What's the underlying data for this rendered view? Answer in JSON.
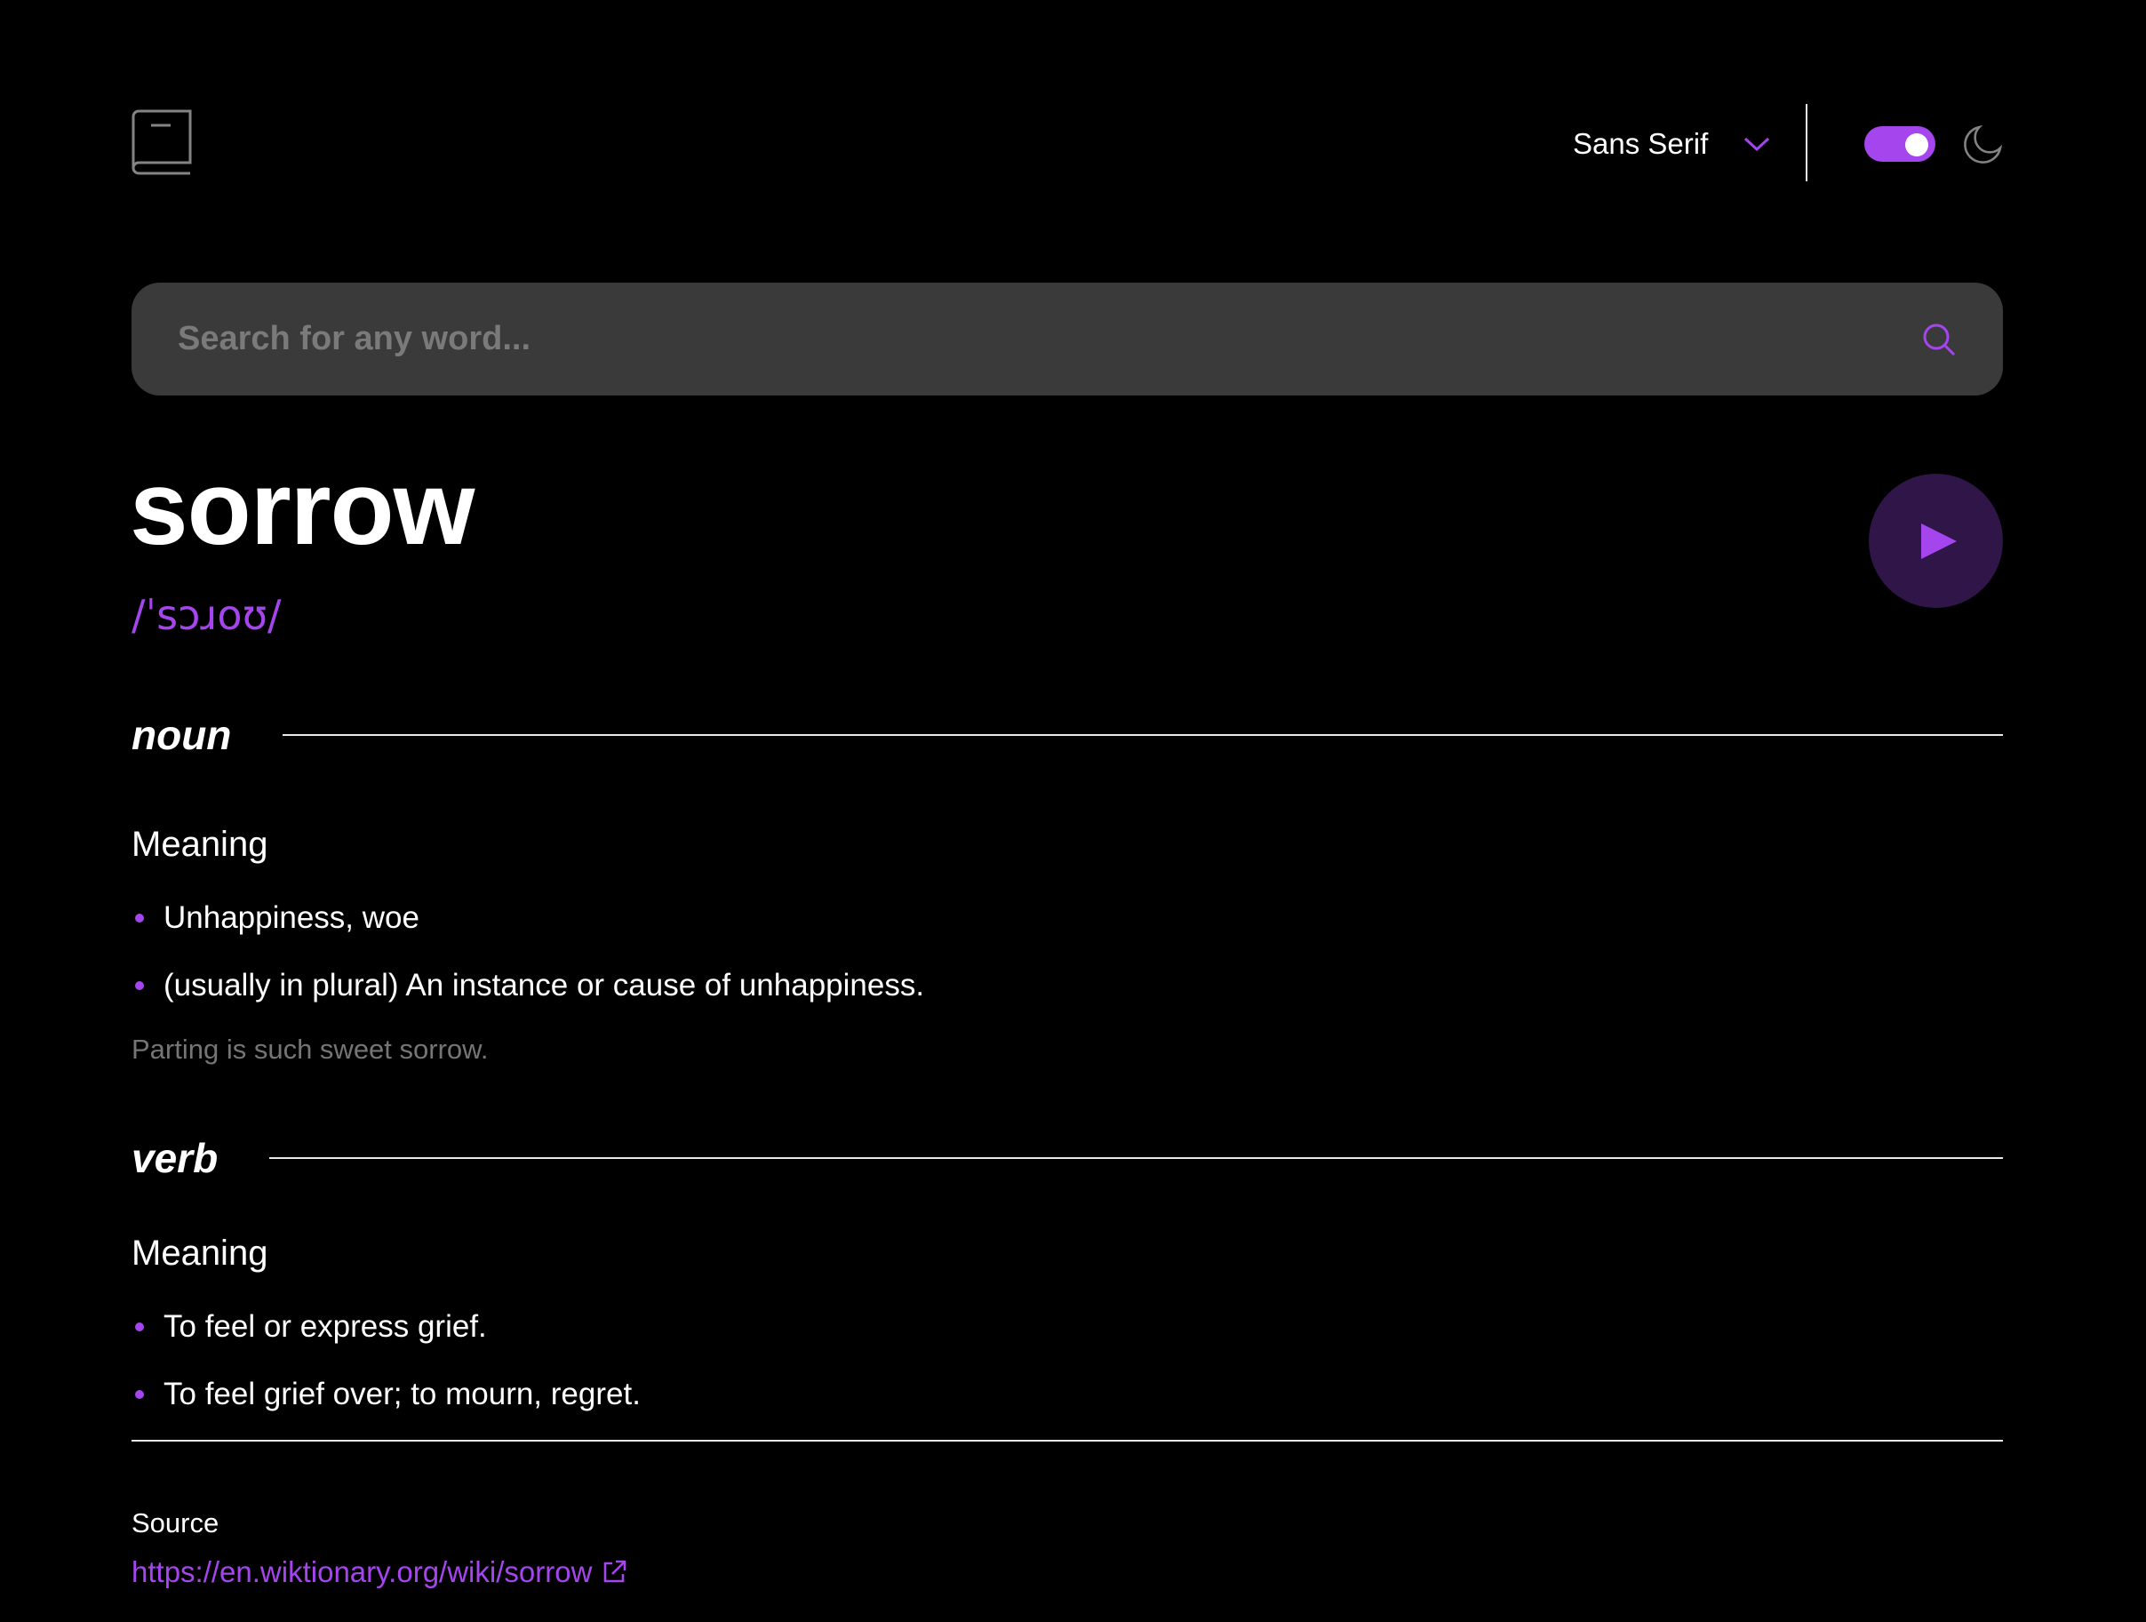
{
  "header": {
    "logo_icon": "book-icon",
    "font_select": {
      "selected": "Sans Serif",
      "icon": "chevron-down-icon"
    },
    "theme_toggle": {
      "on": true,
      "icon": "moon-icon"
    }
  },
  "search": {
    "placeholder": "Search for any word...",
    "value": "",
    "icon": "search-icon"
  },
  "entry": {
    "word": "sorrow",
    "phonetic": "/ˈsɔɹoʊ/",
    "play_icon": "play-icon",
    "meanings": [
      {
        "part_of_speech": "noun",
        "label": "Meaning",
        "definitions": [
          "Unhappiness, woe",
          "(usually in plural) An instance or cause of unhappiness."
        ],
        "example": "Parting is such sweet sorrow."
      },
      {
        "part_of_speech": "verb",
        "label": "Meaning",
        "definitions": [
          "To feel or express grief.",
          "To feel grief over; to mourn, regret."
        ]
      }
    ]
  },
  "source": {
    "label": "Source",
    "url": "https://en.wiktionary.org/wiki/sorrow",
    "icon": "external-link-icon"
  },
  "colors": {
    "accent": "#a445ed",
    "background": "#000000",
    "search_bg": "#3a3a3a",
    "muted_text": "#757575"
  }
}
